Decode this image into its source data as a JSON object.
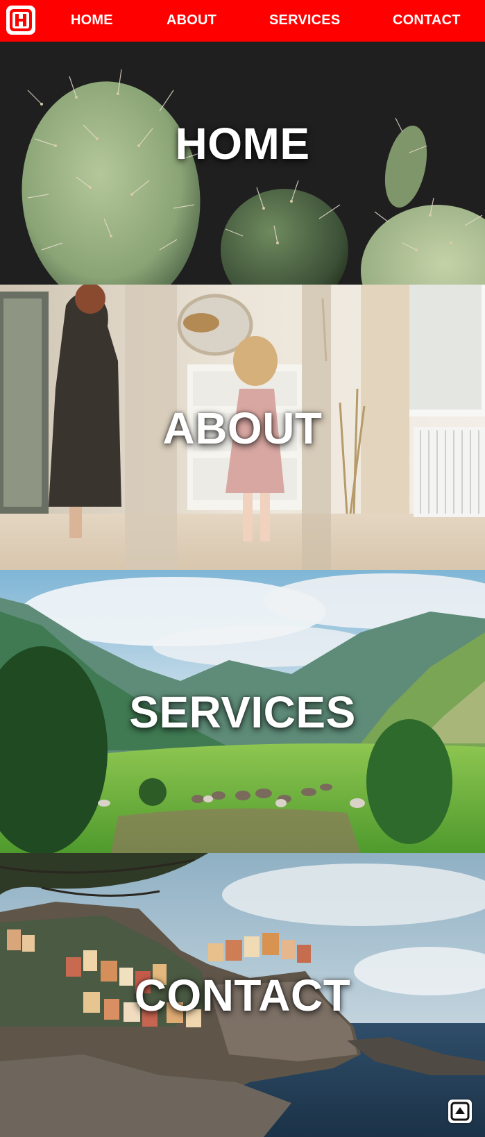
{
  "nav": {
    "logo_letter": "H",
    "links": {
      "home": "HOME",
      "about": "ABOUT",
      "services": "SERVICES",
      "contact": "CONTACT"
    }
  },
  "sections": {
    "home": {
      "title": "HOME",
      "image": "cactus-photo"
    },
    "about": {
      "title": "ABOUT",
      "image": "mother-daughter-room-photo"
    },
    "services": {
      "title": "SERVICES",
      "image": "mountain-valley-cows-photo"
    },
    "contact": {
      "title": "CONTACT",
      "image": "cliffside-village-sea-photo"
    }
  },
  "back_to_top": {
    "icon": "arrow-up-icon"
  },
  "colors": {
    "nav_bg": "#ff0000",
    "nav_text": "#ffffff",
    "title_text": "#ffffff"
  }
}
